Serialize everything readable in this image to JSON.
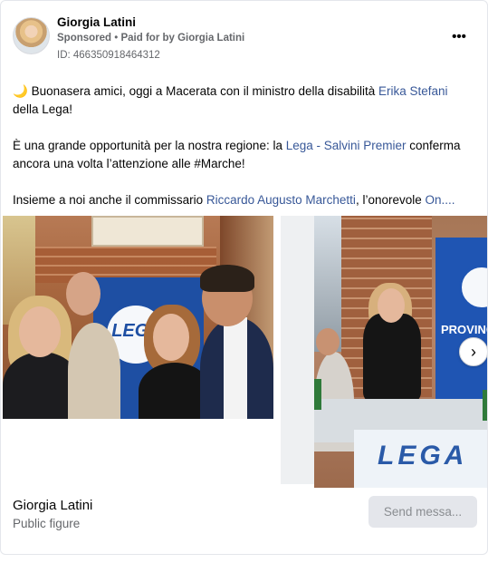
{
  "header": {
    "page_name": "Giorgia Latini",
    "sponsored": "Sponsored",
    "separator": " • ",
    "paid_for": "Paid for by Giorgia Latini",
    "ad_id": "ID: 466350918464312",
    "more_label": "•••"
  },
  "post": {
    "line1_emoji": "🌙",
    "line1_text": " Buonasera amici, oggi a Macerata con il ministro della disabilità ",
    "line1_link": "Erika Stefani",
    "line2_text": "della Lega!",
    "line3_text": "È una grande opportunità per la nostra regione: la ",
    "line3_link": "Lega - Salvini Premier",
    "line3_text_after": " conferma",
    "line4_text": "ancora una volta l’attenzione alle #Marche!",
    "line5_text": "Insieme a noi anche il commissario ",
    "line5_link1": "Riccardo Augusto Marchetti",
    "line5_text_mid": ", l’onorevole ",
    "line5_link2": "On...."
  },
  "carousel": {
    "photo1_logo": "LEGA",
    "photo2_banner": "PROVINC",
    "photo2_cloth": "LEGA",
    "next_label": "›"
  },
  "footer": {
    "name": "Giorgia Latini",
    "category": "Public figure",
    "send_button": "Send messa..."
  },
  "colors": {
    "link": "#385898",
    "secondary_text": "#65676b",
    "button_bg": "#e4e6eb"
  }
}
